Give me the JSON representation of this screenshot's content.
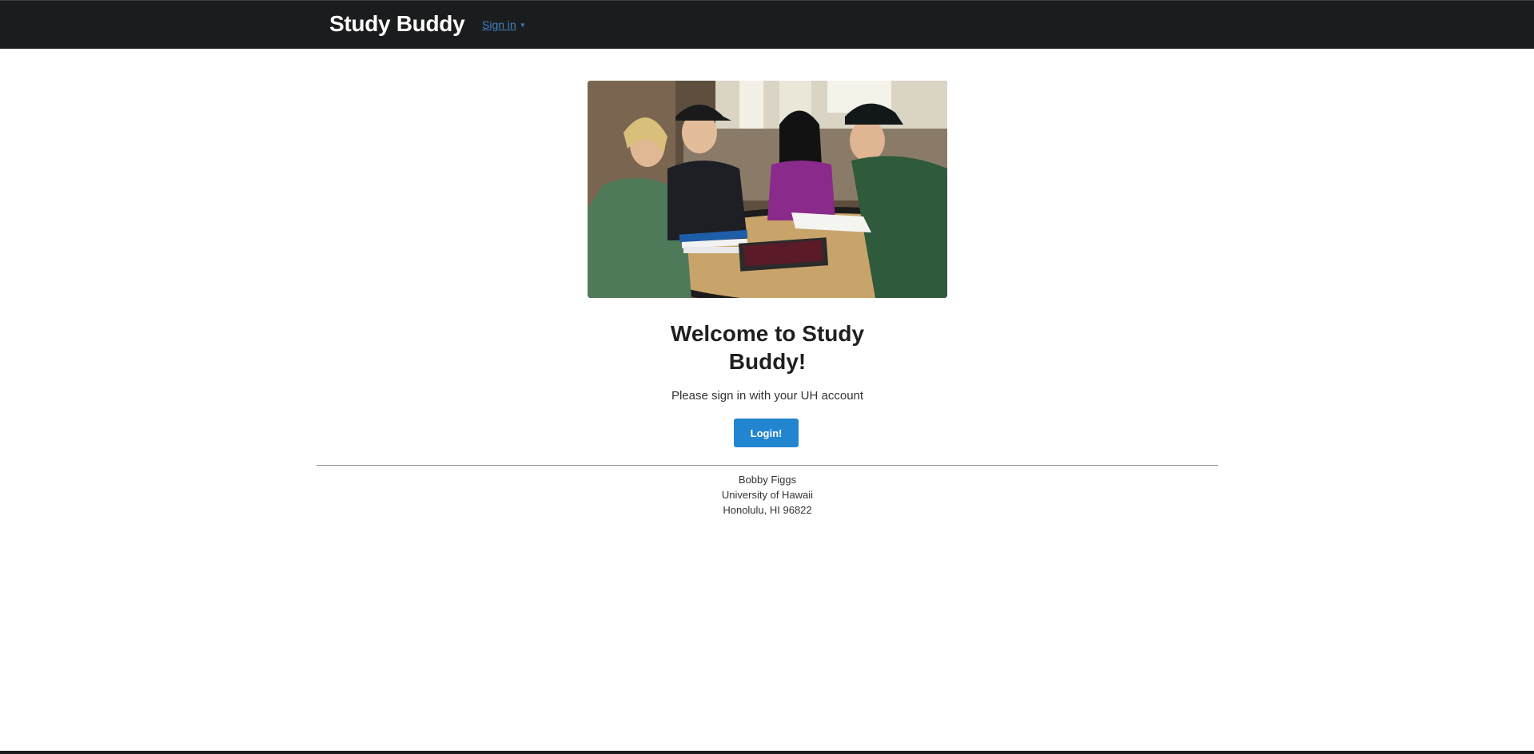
{
  "navbar": {
    "brand": "Study Buddy",
    "signin_label": "Sign in",
    "signin_caret": "▼"
  },
  "hero": {
    "image_subject": "students-studying-photo"
  },
  "main": {
    "welcome_heading": "Welcome to Study Buddy!",
    "subtitle": "Please sign in with your UH account",
    "login_button": "Login!"
  },
  "footer": {
    "name": "Bobby Figgs",
    "university": "University of Hawaii",
    "address": "Honolulu, HI 96822"
  },
  "colors": {
    "navbar_bg": "#1b1c1d",
    "accent": "#2185d0",
    "link": "#4183c4"
  }
}
